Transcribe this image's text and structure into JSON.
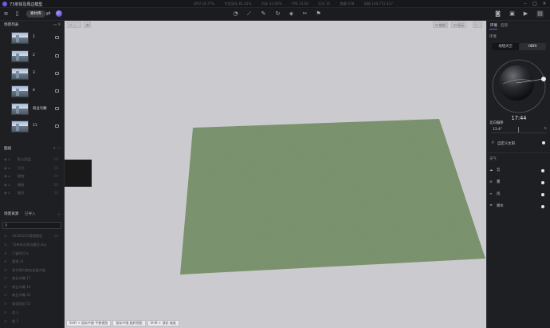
{
  "app": {
    "title": "73单体及周边模型",
    "stats": [
      "GPU 18.77%",
      "专用显存 81.41%",
      "内存 33.56%",
      "FPS 13.00",
      "灯光 15",
      "数量 678",
      "网格 104,772,417"
    ],
    "material_library_label": "素材库"
  },
  "scene_list": {
    "title": "场景列表",
    "items": [
      {
        "label": "1"
      },
      {
        "label": "2"
      },
      {
        "label": "3"
      },
      {
        "label": "4"
      },
      {
        "label": "商业鸟瞰"
      },
      {
        "label": "11"
      }
    ]
  },
  "layers": {
    "title": "图层",
    "items": [
      {
        "label": "默认图层",
        "num": "10"
      },
      {
        "label": "灯光",
        "num": "10"
      },
      {
        "label": "植物",
        "num": "10"
      },
      {
        "label": "模板",
        "num": "10"
      },
      {
        "label": "路径",
        "num": "10"
      }
    ]
  },
  "assets": {
    "title": "场景资源",
    "tab2": "已导入",
    "items": [
      {
        "label": "20180221周围模型",
        "num": "10"
      },
      {
        "label": "73单体及周边模型.skp",
        "num": ""
      },
      {
        "label": "门窗的灯光",
        "num": ""
      },
      {
        "label": "素描 21",
        "num": ""
      },
      {
        "label": "现代简约商务会展大楼",
        "num": ""
      },
      {
        "label": "商业鸟瞰 17",
        "num": ""
      },
      {
        "label": "商业鸟瞰 12",
        "num": ""
      },
      {
        "label": "商业鸟瞰 20",
        "num": ""
      },
      {
        "label": "商务园区 01",
        "num": ""
      },
      {
        "label": "组 3",
        "num": ""
      },
      {
        "label": "组 2",
        "num": ""
      }
    ]
  },
  "viewport": {
    "buttons_right": [
      "相机",
      "显示"
    ],
    "bottom_buttons": [
      "Shift + 鼠标中键 平移视图",
      "鼠标中键 旋转视图",
      "Shift + 滚轮 缩放"
    ]
  },
  "right_panel": {
    "tabs": [
      "环境",
      "后期"
    ],
    "env_label": "环境",
    "segment": [
      "地理天空",
      "HDRI"
    ],
    "time": "17:44",
    "north_label": "北向偏移",
    "north_value": "13.4°",
    "custom_sun_label": "自定义太阳",
    "weather_title": "天气",
    "weather_items": [
      "云",
      "雾",
      "风",
      "降水"
    ]
  },
  "colors": {
    "accent": "#6b5cf0",
    "ground": "#7f9872",
    "viewport_bg": "#cbcbcf"
  }
}
